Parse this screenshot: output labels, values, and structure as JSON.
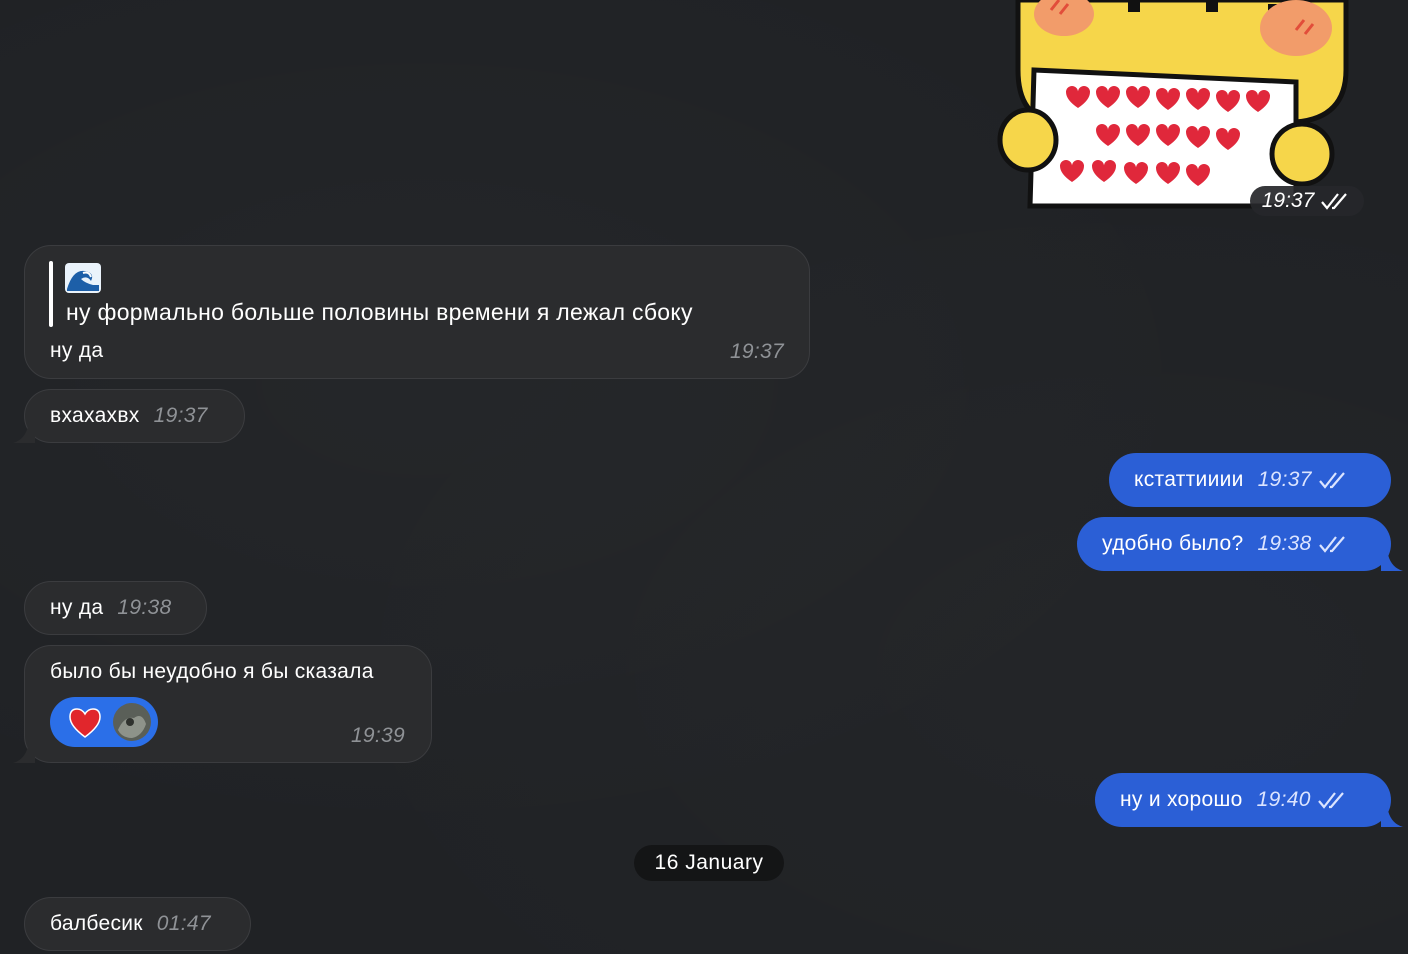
{
  "colors": {
    "background": "#202225",
    "incoming_bubble": "#2b2c2e",
    "outgoing_bubble": "#2b5fd6",
    "timestamp_incoming": "#8f9296",
    "reaction_pill": "#2b6fe8"
  },
  "sticker": {
    "icon": "cat-holding-hearts-sticker",
    "time": "19:37",
    "status": "read-double-check"
  },
  "messages": [
    {
      "id": "m1",
      "direction": "incoming",
      "quote_icon": "wave-emoji",
      "quote_emoji": "🌊",
      "quote_text": "ну формально больше половины времени я лежал сбоку",
      "text": "ну да",
      "time": "19:37"
    },
    {
      "id": "m2",
      "direction": "incoming",
      "text": "вхахахвх",
      "time": "19:37"
    },
    {
      "id": "m3",
      "direction": "outgoing",
      "text": "кстаттииии",
      "time": "19:37",
      "status": "read-double-check"
    },
    {
      "id": "m4",
      "direction": "outgoing",
      "text": "удобно было?",
      "time": "19:38",
      "status": "read-double-check"
    },
    {
      "id": "m5",
      "direction": "incoming",
      "text": "ну да",
      "time": "19:38"
    },
    {
      "id": "m6",
      "direction": "incoming",
      "text": "было бы неудобно я бы сказала",
      "time": "19:39",
      "reaction": {
        "emoji": "heart-icon",
        "avatar": "user-avatar"
      }
    },
    {
      "id": "m7",
      "direction": "outgoing",
      "text": "ну и хорошо",
      "time": "19:40",
      "status": "read-double-check"
    }
  ],
  "date_separator": "16 January",
  "last_message": {
    "id": "m8",
    "direction": "incoming",
    "text": "балбесик",
    "time": "01:47"
  }
}
